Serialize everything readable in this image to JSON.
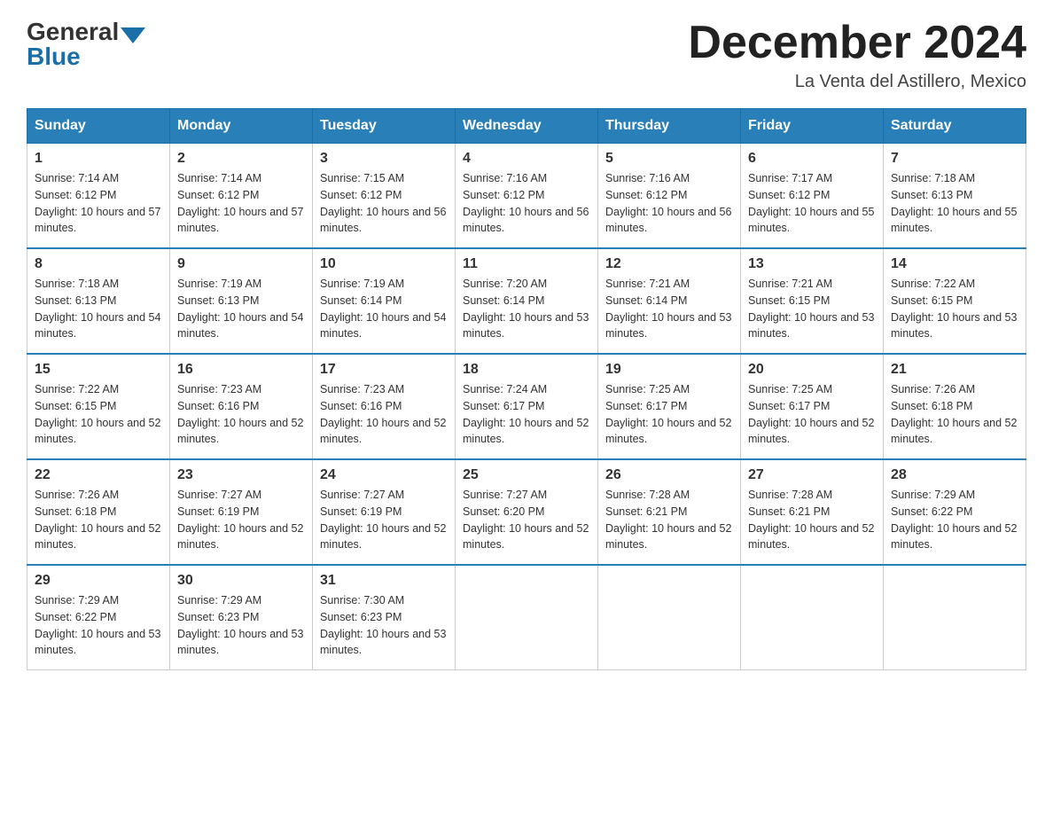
{
  "header": {
    "logo_general": "General",
    "logo_blue": "Blue",
    "month_year": "December 2024",
    "location": "La Venta del Astillero, Mexico"
  },
  "days_of_week": [
    "Sunday",
    "Monday",
    "Tuesday",
    "Wednesday",
    "Thursday",
    "Friday",
    "Saturday"
  ],
  "weeks": [
    [
      {
        "day": "1",
        "sunrise": "7:14 AM",
        "sunset": "6:12 PM",
        "daylight": "10 hours and 57 minutes."
      },
      {
        "day": "2",
        "sunrise": "7:14 AM",
        "sunset": "6:12 PM",
        "daylight": "10 hours and 57 minutes."
      },
      {
        "day": "3",
        "sunrise": "7:15 AM",
        "sunset": "6:12 PM",
        "daylight": "10 hours and 56 minutes."
      },
      {
        "day": "4",
        "sunrise": "7:16 AM",
        "sunset": "6:12 PM",
        "daylight": "10 hours and 56 minutes."
      },
      {
        "day": "5",
        "sunrise": "7:16 AM",
        "sunset": "6:12 PM",
        "daylight": "10 hours and 56 minutes."
      },
      {
        "day": "6",
        "sunrise": "7:17 AM",
        "sunset": "6:12 PM",
        "daylight": "10 hours and 55 minutes."
      },
      {
        "day": "7",
        "sunrise": "7:18 AM",
        "sunset": "6:13 PM",
        "daylight": "10 hours and 55 minutes."
      }
    ],
    [
      {
        "day": "8",
        "sunrise": "7:18 AM",
        "sunset": "6:13 PM",
        "daylight": "10 hours and 54 minutes."
      },
      {
        "day": "9",
        "sunrise": "7:19 AM",
        "sunset": "6:13 PM",
        "daylight": "10 hours and 54 minutes."
      },
      {
        "day": "10",
        "sunrise": "7:19 AM",
        "sunset": "6:14 PM",
        "daylight": "10 hours and 54 minutes."
      },
      {
        "day": "11",
        "sunrise": "7:20 AM",
        "sunset": "6:14 PM",
        "daylight": "10 hours and 53 minutes."
      },
      {
        "day": "12",
        "sunrise": "7:21 AM",
        "sunset": "6:14 PM",
        "daylight": "10 hours and 53 minutes."
      },
      {
        "day": "13",
        "sunrise": "7:21 AM",
        "sunset": "6:15 PM",
        "daylight": "10 hours and 53 minutes."
      },
      {
        "day": "14",
        "sunrise": "7:22 AM",
        "sunset": "6:15 PM",
        "daylight": "10 hours and 53 minutes."
      }
    ],
    [
      {
        "day": "15",
        "sunrise": "7:22 AM",
        "sunset": "6:15 PM",
        "daylight": "10 hours and 52 minutes."
      },
      {
        "day": "16",
        "sunrise": "7:23 AM",
        "sunset": "6:16 PM",
        "daylight": "10 hours and 52 minutes."
      },
      {
        "day": "17",
        "sunrise": "7:23 AM",
        "sunset": "6:16 PM",
        "daylight": "10 hours and 52 minutes."
      },
      {
        "day": "18",
        "sunrise": "7:24 AM",
        "sunset": "6:17 PM",
        "daylight": "10 hours and 52 minutes."
      },
      {
        "day": "19",
        "sunrise": "7:25 AM",
        "sunset": "6:17 PM",
        "daylight": "10 hours and 52 minutes."
      },
      {
        "day": "20",
        "sunrise": "7:25 AM",
        "sunset": "6:17 PM",
        "daylight": "10 hours and 52 minutes."
      },
      {
        "day": "21",
        "sunrise": "7:26 AM",
        "sunset": "6:18 PM",
        "daylight": "10 hours and 52 minutes."
      }
    ],
    [
      {
        "day": "22",
        "sunrise": "7:26 AM",
        "sunset": "6:18 PM",
        "daylight": "10 hours and 52 minutes."
      },
      {
        "day": "23",
        "sunrise": "7:27 AM",
        "sunset": "6:19 PM",
        "daylight": "10 hours and 52 minutes."
      },
      {
        "day": "24",
        "sunrise": "7:27 AM",
        "sunset": "6:19 PM",
        "daylight": "10 hours and 52 minutes."
      },
      {
        "day": "25",
        "sunrise": "7:27 AM",
        "sunset": "6:20 PM",
        "daylight": "10 hours and 52 minutes."
      },
      {
        "day": "26",
        "sunrise": "7:28 AM",
        "sunset": "6:21 PM",
        "daylight": "10 hours and 52 minutes."
      },
      {
        "day": "27",
        "sunrise": "7:28 AM",
        "sunset": "6:21 PM",
        "daylight": "10 hours and 52 minutes."
      },
      {
        "day": "28",
        "sunrise": "7:29 AM",
        "sunset": "6:22 PM",
        "daylight": "10 hours and 52 minutes."
      }
    ],
    [
      {
        "day": "29",
        "sunrise": "7:29 AM",
        "sunset": "6:22 PM",
        "daylight": "10 hours and 53 minutes."
      },
      {
        "day": "30",
        "sunrise": "7:29 AM",
        "sunset": "6:23 PM",
        "daylight": "10 hours and 53 minutes."
      },
      {
        "day": "31",
        "sunrise": "7:30 AM",
        "sunset": "6:23 PM",
        "daylight": "10 hours and 53 minutes."
      },
      null,
      null,
      null,
      null
    ]
  ]
}
